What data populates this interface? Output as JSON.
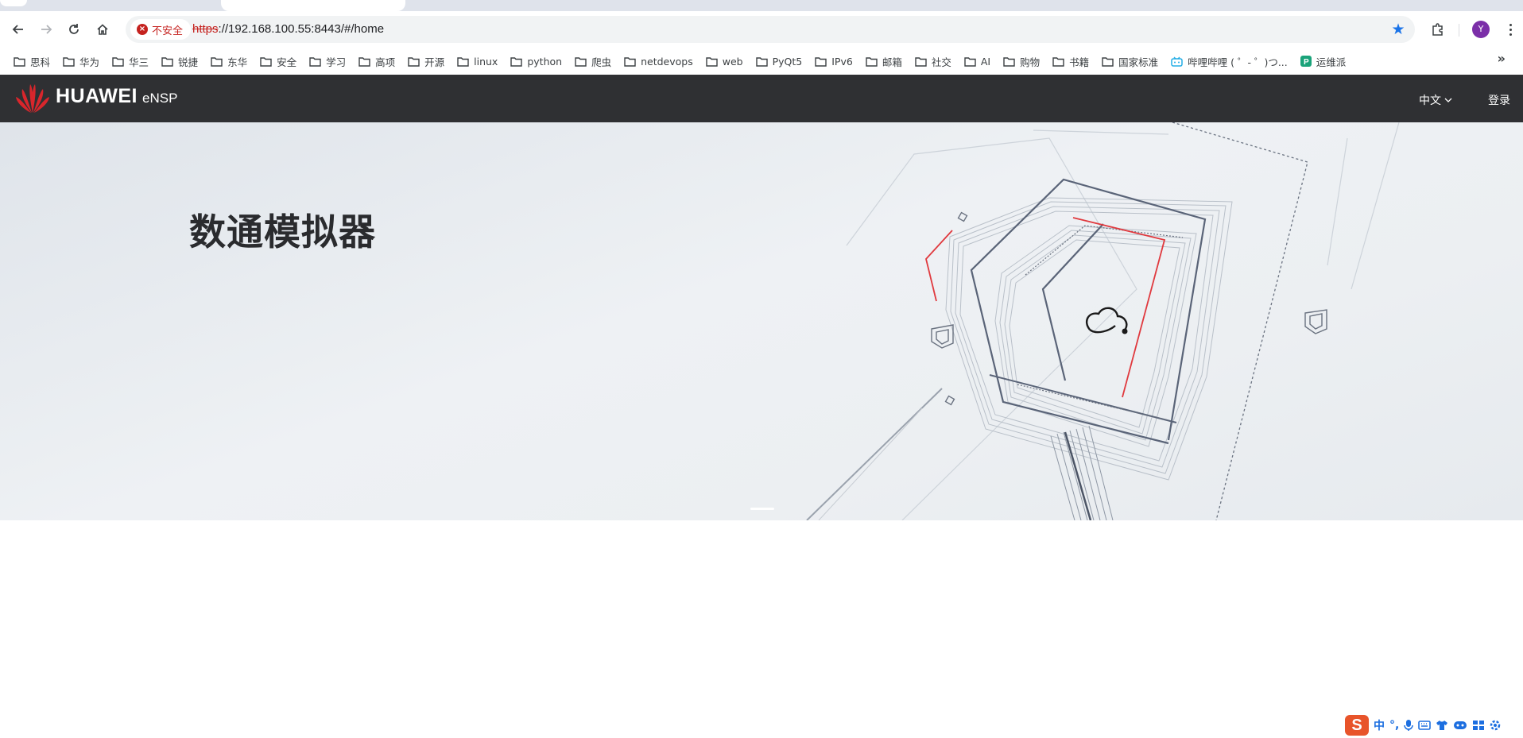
{
  "browser": {
    "url_scheme": "https",
    "url_rest": "://192.168.100.55:8443/#/home",
    "security_label": "不安全",
    "profile_initial": "Y",
    "bookmarks": [
      {
        "label": "思科",
        "icon": "folder-icon"
      },
      {
        "label": "华为",
        "icon": "folder-icon"
      },
      {
        "label": "华三",
        "icon": "folder-icon"
      },
      {
        "label": "锐捷",
        "icon": "folder-icon"
      },
      {
        "label": "东华",
        "icon": "folder-icon"
      },
      {
        "label": "安全",
        "icon": "folder-icon"
      },
      {
        "label": "学习",
        "icon": "folder-icon"
      },
      {
        "label": "高项",
        "icon": "folder-icon"
      },
      {
        "label": "开源",
        "icon": "folder-icon"
      },
      {
        "label": "linux",
        "icon": "folder-icon"
      },
      {
        "label": "python",
        "icon": "folder-icon"
      },
      {
        "label": "爬虫",
        "icon": "folder-icon"
      },
      {
        "label": "netdevops",
        "icon": "folder-icon"
      },
      {
        "label": "web",
        "icon": "folder-icon"
      },
      {
        "label": "PyQt5",
        "icon": "folder-icon"
      },
      {
        "label": "IPv6",
        "icon": "folder-icon"
      },
      {
        "label": "邮箱",
        "icon": "folder-icon"
      },
      {
        "label": "社交",
        "icon": "folder-icon"
      },
      {
        "label": "AI",
        "icon": "folder-icon"
      },
      {
        "label": "购物",
        "icon": "folder-icon"
      },
      {
        "label": "书籍",
        "icon": "folder-icon"
      },
      {
        "label": "国家标准",
        "icon": "folder-icon"
      },
      {
        "label": "哔哩哔哩 ( ゜- ゜)つ...",
        "icon": "bilibili-icon"
      },
      {
        "label": "运维派",
        "icon": "p-icon"
      }
    ],
    "overflow_label": "»"
  },
  "site": {
    "brand": "HUAWEI",
    "product": "eNSP",
    "language": "中文",
    "login": "登录"
  },
  "hero": {
    "title": "数通模拟器"
  },
  "ime": {
    "logo": "S",
    "mode": "中",
    "punct": "°,"
  },
  "colors": {
    "header_bg": "#2f3033",
    "accent_red": "#e0393e",
    "bookmark_star": "#1a73e8",
    "ime_blue": "#1d6fe0"
  }
}
